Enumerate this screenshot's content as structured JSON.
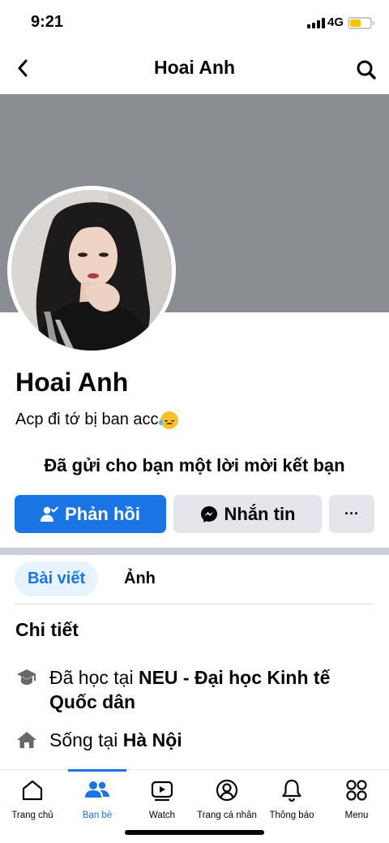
{
  "status": {
    "time": "9:21",
    "network": "4G",
    "battery_level": 0.55
  },
  "header": {
    "title": "Hoai Anh"
  },
  "profile": {
    "name": "Hoai Anh",
    "bio": "Acp đi tớ bị ban acc",
    "bio_emoji": "anxious-face-with-sweat-emoji",
    "friend_request_text": "Đã gửi cho bạn một lời mời kết bạn"
  },
  "actions": {
    "respond_label": "Phản hồi",
    "message_label": "Nhắn tin",
    "more_label": "···"
  },
  "tabs": [
    {
      "label": "Bài viết",
      "active": true
    },
    {
      "label": "Ảnh",
      "active": false
    }
  ],
  "details": {
    "title": "Chi tiết",
    "education": {
      "prefix": "Đã học tại ",
      "value": "NEU - Đại học Kinh tế Quốc dân"
    },
    "lives": {
      "prefix": "Sống tại ",
      "value": "Hà Nội"
    }
  },
  "bottom_nav": [
    {
      "label": "Trang chủ",
      "icon": "home-icon",
      "active": false
    },
    {
      "label": "Bạn bè",
      "icon": "friends-icon",
      "active": true
    },
    {
      "label": "Watch",
      "icon": "watch-icon",
      "active": false
    },
    {
      "label": "Trang cá nhân",
      "icon": "profile-icon",
      "active": false
    },
    {
      "label": "Thông báo",
      "icon": "bell-icon",
      "active": false
    },
    {
      "label": "Menu",
      "icon": "menu-grid-icon",
      "active": false
    }
  ],
  "colors": {
    "accent": "#1b74e4",
    "cover": "#8a8e93",
    "button_gray": "#e4e6eb"
  }
}
